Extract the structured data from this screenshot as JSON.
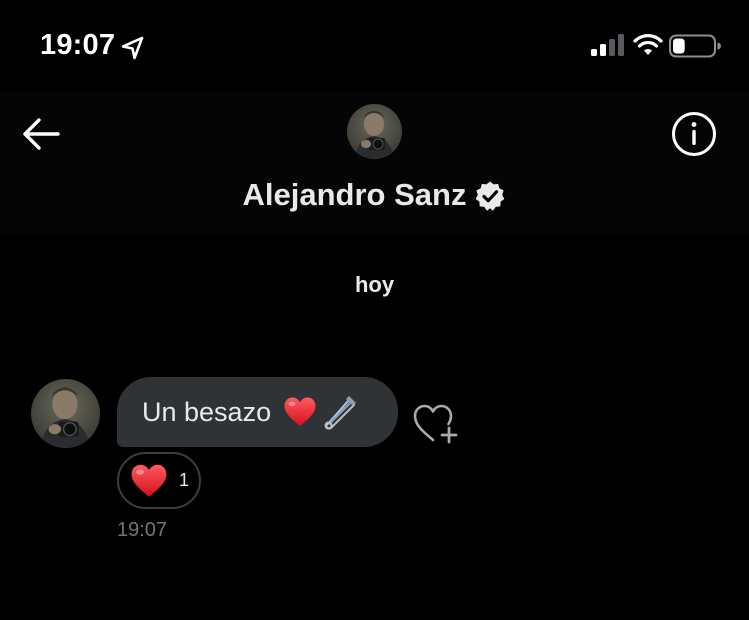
{
  "status_bar": {
    "time": "19:07",
    "location_icon": "location-arrow-icon",
    "signal_icon": "cellular-signal-icon",
    "wifi_icon": "wifi-icon",
    "battery_icon": "battery-icon",
    "battery_level": 0.3
  },
  "header": {
    "back_icon": "arrow-left-icon",
    "contact_name": "Alejandro Sanz",
    "verified_icon": "verified-badge-icon",
    "info_icon": "info-circle-icon"
  },
  "conversation": {
    "date_divider": "hoy",
    "messages": [
      {
        "text": "Un besazo",
        "emojis": [
          "red-heart-emoji",
          "safety-pin-emoji"
        ],
        "reaction": {
          "emoji": "red-heart-emoji",
          "count": "1"
        },
        "time": "19:07"
      }
    ],
    "add_reaction_icon": "heart-plus-icon"
  },
  "colors": {
    "background": "#000000",
    "bubble": "#2f3336",
    "text": "#e7e9ea",
    "muted_text": "#71767b",
    "heart": "#e0242f"
  }
}
